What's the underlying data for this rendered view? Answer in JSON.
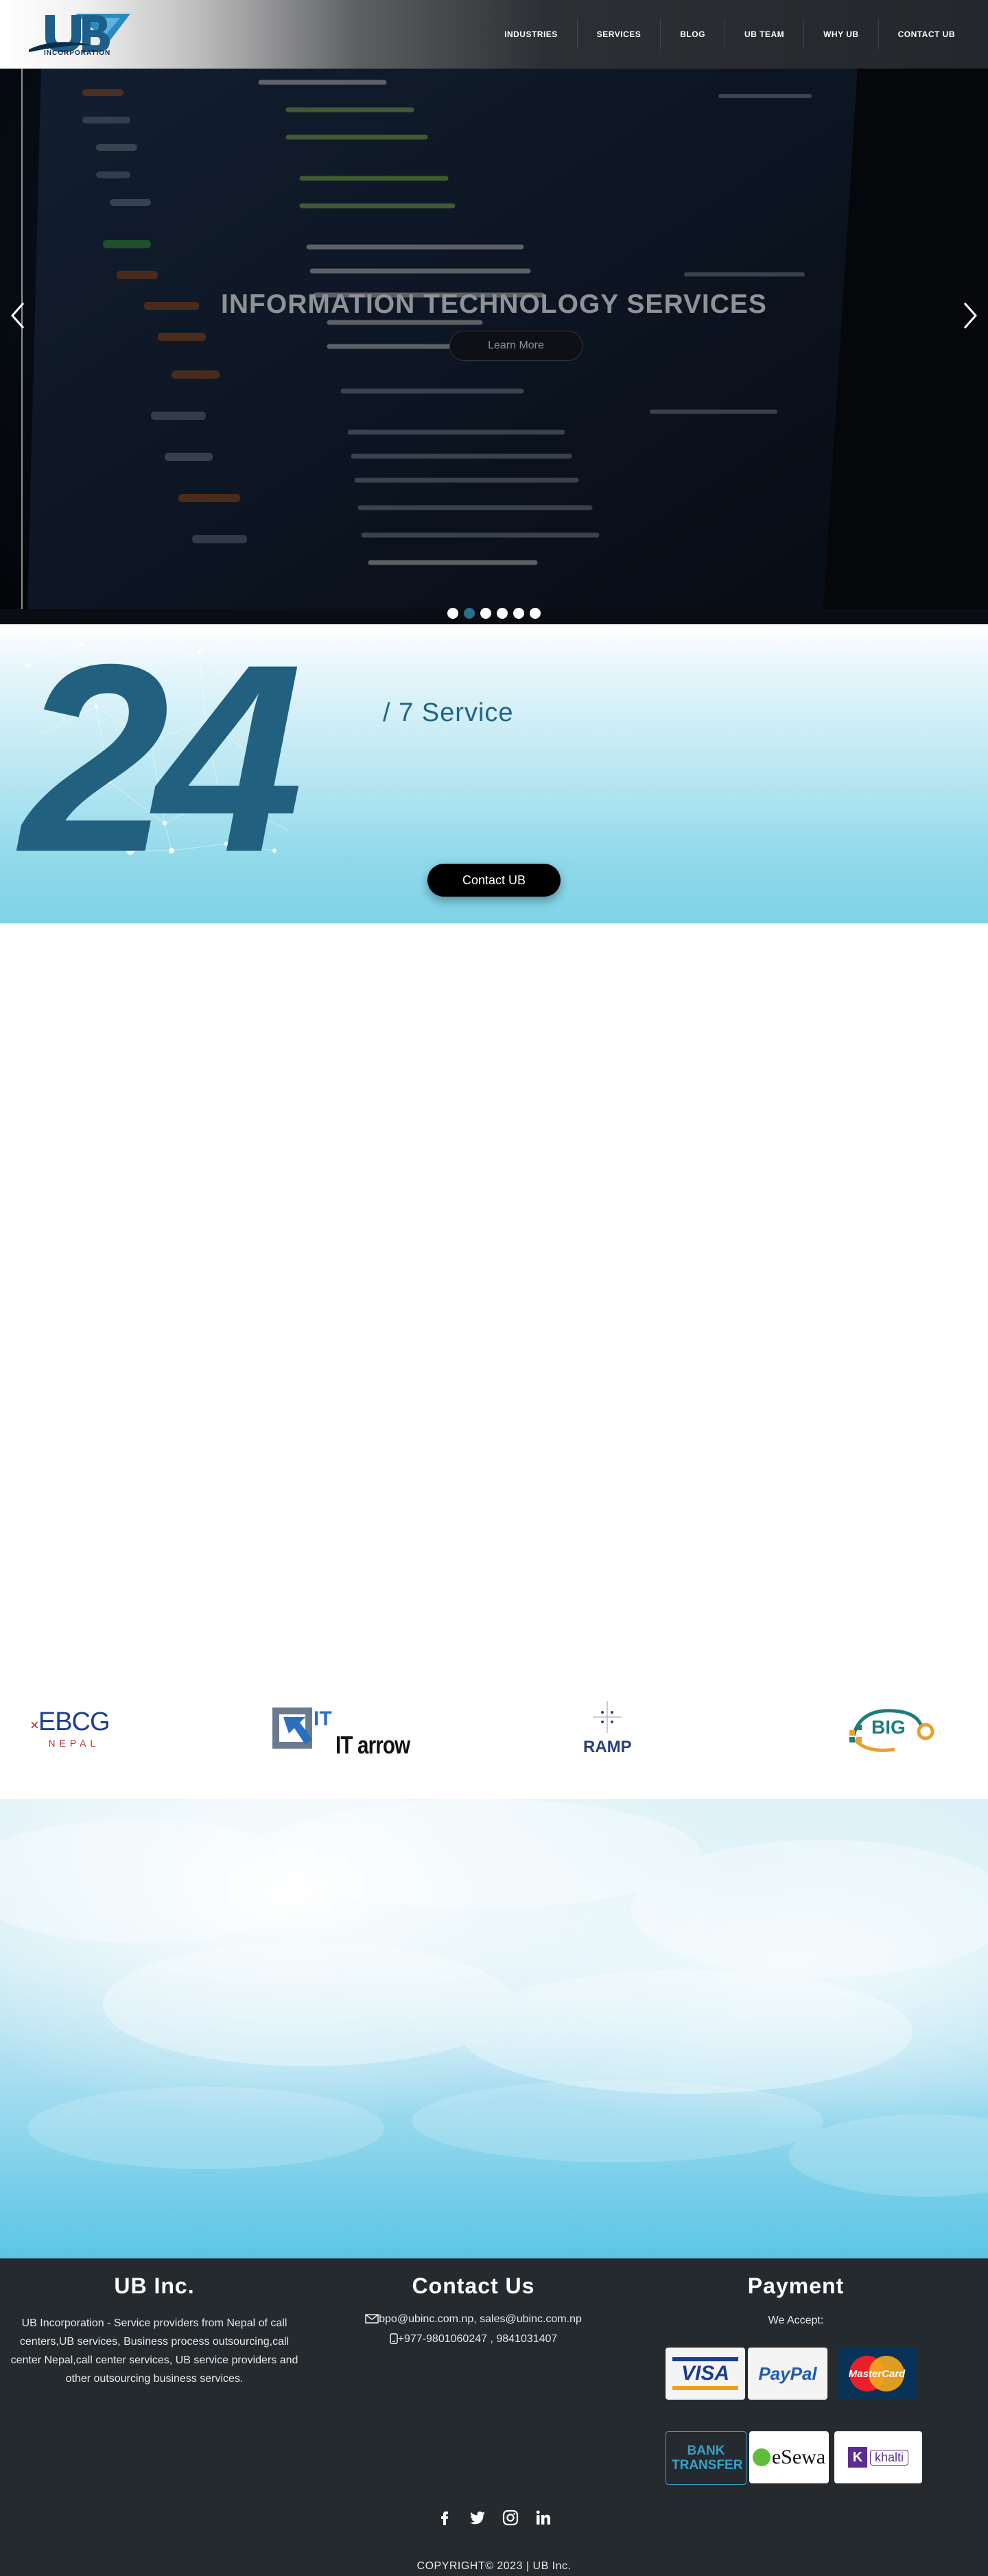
{
  "header": {
    "logo_text": "INCORPORATION",
    "logo_mark": "UB",
    "nav": [
      "INDUSTRIES",
      "SERVICES",
      "BLOG",
      "UB TEAM",
      "WHY UB",
      "CONTACT UB"
    ]
  },
  "hero": {
    "title": "INFORMATION TECHNOLOGY SERVICES",
    "button": "Learn More",
    "slide_count": 6,
    "active_slide_index": 1
  },
  "service": {
    "big_number": "24",
    "subtitle": "/ 7 Service",
    "button": "Contact UB"
  },
  "partners": [
    {
      "name": "EBCG",
      "sub": "NEPAL"
    },
    {
      "name": "IT arrow"
    },
    {
      "name": "RAMP"
    },
    {
      "name": "BIG"
    }
  ],
  "footer": {
    "about": {
      "title": "UB Inc.",
      "text": "UB Incorporation - Service providers from Nepal of call centers,UB services, Business process outsourcing,call center Nepal,call center services, UB service providers and other outsourcing business services."
    },
    "contact": {
      "title": "Contact Us",
      "email": "bpo@ubinc.com.np, sales@ubinc.com.np",
      "phone": "+977-9801060247 , 9841031407"
    },
    "payment": {
      "title": "Payment",
      "subtitle": "We Accept:",
      "methods": [
        "VISA",
        "PayPal",
        "MasterCard",
        "BANK TRANSFER",
        "eSewa",
        "khalti"
      ]
    },
    "socials": [
      "facebook-icon",
      "twitter-icon",
      "instagram-icon",
      "linkedin-icon"
    ],
    "copyright": "COPYRIGHT© 2023  | UB Inc."
  },
  "colors": {
    "accent": "#21607e",
    "footer_bg": "#252a2e"
  }
}
